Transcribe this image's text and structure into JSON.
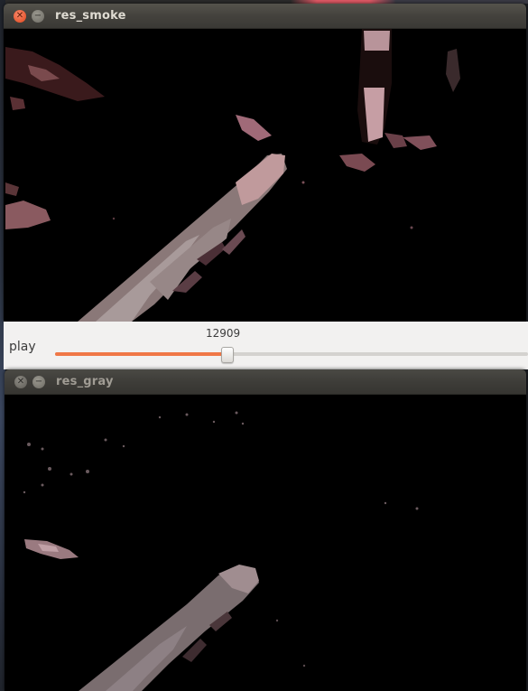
{
  "windows": {
    "smoke": {
      "title": "res_smoke"
    },
    "gray": {
      "title": "res_gray"
    }
  },
  "trackbar": {
    "label": "play",
    "value_text": "12909",
    "position_fraction": 0.365
  },
  "colors": {
    "accent": "#f07746",
    "titlebar": "#44423d",
    "close_button": "#e1471c",
    "panel_bg": "#f2f1f0"
  },
  "icons": {
    "close": "close-icon",
    "minimize": "minimize-icon"
  }
}
